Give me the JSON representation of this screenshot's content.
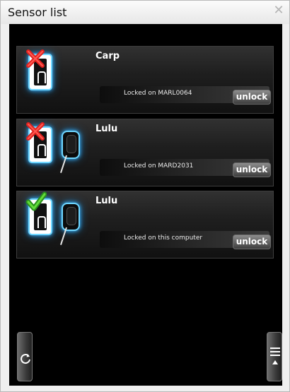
{
  "window": {
    "title": "Sensor list",
    "close_icon": "close-icon"
  },
  "sensors": [
    {
      "name": "Carp",
      "status_icon": "x-icon",
      "devices": [
        "card-reader-icon"
      ],
      "locked_text": "Locked on MARL0064",
      "unlock_label": "unlock"
    },
    {
      "name": "Lulu",
      "status_icon": "x-icon",
      "devices": [
        "card-reader-icon",
        "sensor-device-icon"
      ],
      "locked_text": "Locked on MARD2031",
      "unlock_label": "unlock"
    },
    {
      "name": "Lulu",
      "status_icon": "checkmark-icon",
      "devices": [
        "card-reader-icon",
        "sensor-device-icon"
      ],
      "locked_text": "Locked on this computer",
      "unlock_label": "unlock"
    }
  ],
  "footer": {
    "refresh_icon": "refresh-icon",
    "menu_icon": "menu-icon"
  },
  "colors": {
    "panel_bg": "#000000",
    "glow": "#3ab7ff",
    "x_red": "#e0211e",
    "check_green": "#3fbf2c"
  }
}
